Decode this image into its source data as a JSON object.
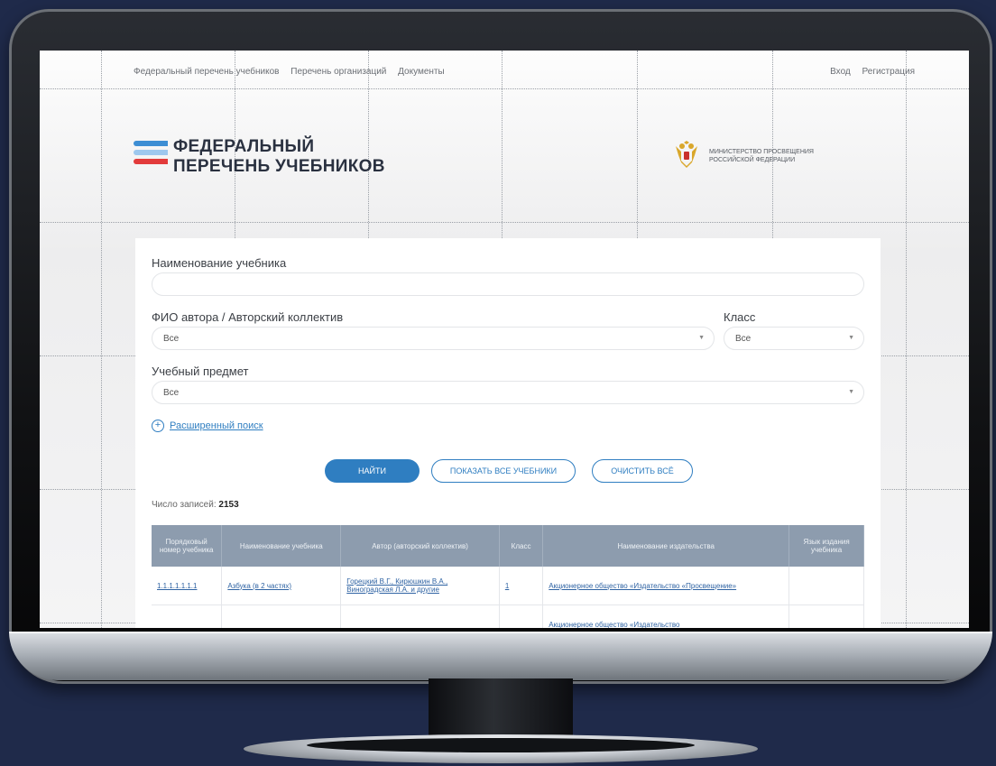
{
  "nav": {
    "items": [
      "Федеральный перечень учебников",
      "Перечень организаций",
      "Документы"
    ],
    "login": "Вход",
    "register": "Регистрация"
  },
  "logo": {
    "line1": "ФЕДЕРАЛЬНЫЙ",
    "line2": "ПЕРЕЧЕНЬ УЧЕБНИКОВ",
    "stripe_colors": [
      "#3d8ed4",
      "#9ec8ee",
      "#e23b3b"
    ]
  },
  "ministry": {
    "line1": "МИНИСТЕРСТВО ПРОСВЕЩЕНИЯ",
    "line2": "РОССИЙСКОЙ ФЕДЕРАЦИИ",
    "icon": "double-headed-eagle-emblem"
  },
  "form": {
    "title_label": "Наименование учебника",
    "title_value": "",
    "author_label": "ФИО автора / Авторский коллектив",
    "author_value": "Все",
    "grade_label": "Класс",
    "grade_value": "Все",
    "subject_label": "Учебный предмет",
    "subject_value": "Все",
    "advanced_search": "Расширенный поиск"
  },
  "buttons": {
    "find": "НАЙТИ",
    "show_all": "ПОКАЗАТЬ ВСЕ УЧЕБНИКИ",
    "clear_all": "ОЧИСТИТЬ ВСЁ"
  },
  "records": {
    "label": "Число записей:",
    "count": "2153"
  },
  "table": {
    "headers": [
      "Порядковый номер учебника",
      "Наименование учебника",
      "Автор (авторский коллектив)",
      "Класс",
      "Наименование издательства",
      "Язык издания учебника"
    ],
    "rows": [
      [
        "1.1.1.1.1.1.1",
        "Азбука (в 2 частях)",
        "Горецкий В.Г., Кирюшкин В.А., Виноградская Л.А. и другие",
        "1",
        "Акционерное общество «Издательство «Просвещение»",
        ""
      ],
      [
        "",
        "",
        "",
        "",
        "Акционерное общество «Издательство",
        ""
      ]
    ]
  },
  "colors": {
    "accent": "#2f7ec1",
    "table_header": "#8d9cae",
    "background": "#1f2a4a"
  }
}
